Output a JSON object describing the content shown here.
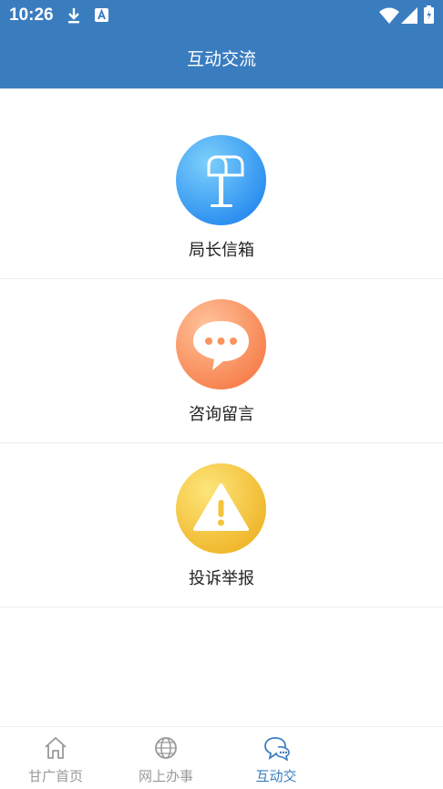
{
  "status_bar": {
    "time": "10:26",
    "icons": [
      "download-icon",
      "a-notification-icon",
      "wifi-icon",
      "signal-icon",
      "battery-icon"
    ]
  },
  "header": {
    "title": "互动交流"
  },
  "menu": [
    {
      "label": "局长信箱",
      "icon": "mailbox-icon",
      "color_from": "#5fbdf7",
      "color_to": "#2c8ff0"
    },
    {
      "label": "咨询留言",
      "icon": "chat-bubble-icon",
      "color_from": "#ffad7c",
      "color_to": "#f7824f"
    },
    {
      "label": "投诉举报",
      "icon": "warning-icon",
      "color_from": "#fbd84c",
      "color_to": "#f0b82d"
    }
  ],
  "tabs": [
    {
      "label": "甘广首页",
      "icon": "home-icon",
      "active": false
    },
    {
      "label": "网上办事",
      "icon": "globe-icon",
      "active": false
    },
    {
      "label": "互动交",
      "icon": "chat-icon",
      "active": true
    }
  ],
  "colors": {
    "primary": "#3a7dbf",
    "tab_inactive": "#999999"
  }
}
